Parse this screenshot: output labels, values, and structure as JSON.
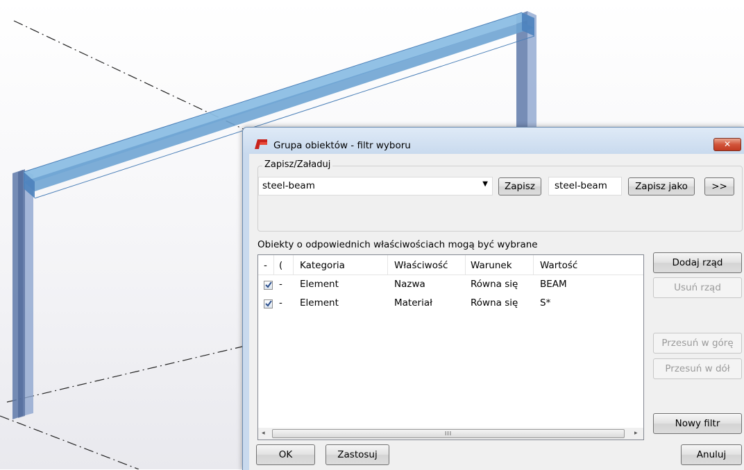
{
  "dialog": {
    "title": "Grupa obiektów - filtr wyboru",
    "close_label": "✕",
    "save_load": {
      "legend": "Zapisz/Załaduj",
      "combo_value": "steel-beam",
      "save_label": "Zapisz",
      "name_value": "steel-beam",
      "save_as_label": "Zapisz jako",
      "expand_label": ">>"
    },
    "hint": "Obiekty o odpowiednich właściwościach mogą być wybrane",
    "table": {
      "headers": [
        "-",
        "(",
        "Kategoria",
        "Właściwość",
        "Warunek",
        "Wartość"
      ],
      "rows": [
        {
          "checked": true,
          "paren": "-",
          "category": "Element",
          "property": "Nazwa",
          "condition": "Równa się",
          "value": "BEAM"
        },
        {
          "checked": true,
          "paren": "-",
          "category": "Element",
          "property": "Materiał",
          "condition": "Równa się",
          "value": "S*"
        }
      ],
      "scroll_left": "◂",
      "scroll_grip": "III",
      "scroll_right": "▸"
    },
    "side_buttons": {
      "add_row": "Dodaj rząd",
      "remove_row": "Usuń rząd",
      "move_up": "Przesuń w górę",
      "move_down": "Przesuń w dół",
      "new_filter": "Nowy filtr"
    },
    "footer": {
      "ok": "OK",
      "apply": "Zastosuj",
      "cancel": "Anuluj"
    }
  },
  "colors": {
    "beam": "#7fb2de",
    "column": "#6c86b4",
    "title_bar": "#c9daee",
    "close_button": "#c84a30"
  },
  "icons": [
    "tekla-app-icon",
    "close-icon",
    "checkbox-checked-icon",
    "dropdown-arrow-icon"
  ]
}
